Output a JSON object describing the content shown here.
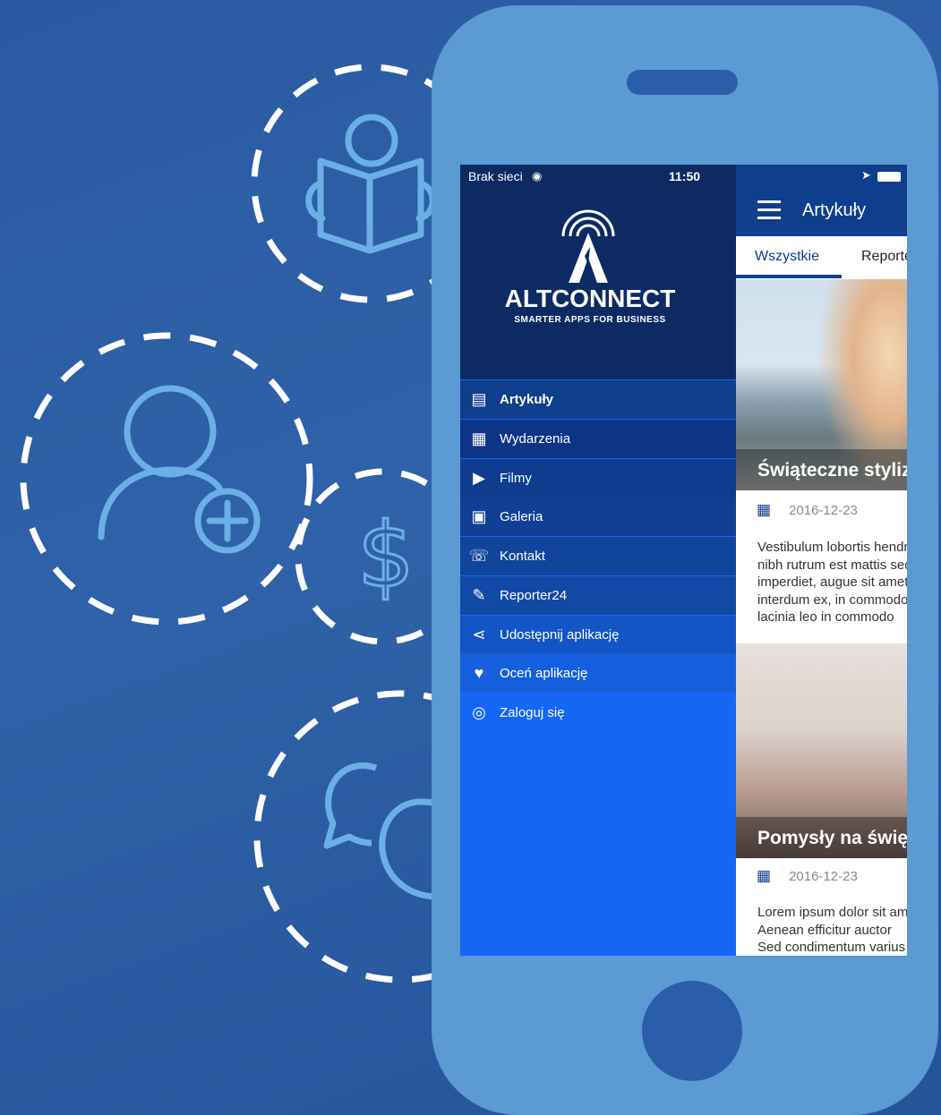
{
  "status_bar": {
    "carrier": "Brak sieci",
    "time": "11:50"
  },
  "brand": {
    "name": "ALTCONNECT",
    "tagline": "SMARTER APPS FOR BUSINESS"
  },
  "menu": [
    {
      "label": "Artykuły",
      "icon": "newspaper-icon",
      "active": true
    },
    {
      "label": "Wydarzenia",
      "icon": "calendar-icon"
    },
    {
      "label": "Filmy",
      "icon": "youtube-icon"
    },
    {
      "label": "Galeria",
      "icon": "gallery-icon"
    },
    {
      "label": "Kontakt",
      "icon": "contact-icon"
    },
    {
      "label": "Reporter24",
      "icon": "microphone-icon"
    },
    {
      "label": "Udostępnij aplikację",
      "icon": "share-icon"
    },
    {
      "label": "Oceń aplikację",
      "icon": "heart-icon"
    },
    {
      "label": "Zaloguj się",
      "icon": "user-icon"
    }
  ],
  "header": {
    "title": "Artykuły"
  },
  "tabs": [
    "Wszystkie",
    "Reporter"
  ],
  "articles": [
    {
      "title": "Świąteczne stylizacje",
      "date": "2016-12-23",
      "excerpt": "Vestibulum lobortis hendrerit\nnibh rutrum est mattis sed\nimperdiet, augue sit amet\ninterdum ex, in commodo\nlacinia leo in commodo"
    },
    {
      "title": "Pomysły na święta",
      "date": "2016-12-23",
      "excerpt": "Lorem ipsum dolor sit amet\nAenean efficitur auctor\nSed condimentum varius"
    }
  ],
  "colors": {
    "background": "#2a5aa3",
    "phone": "#5b9ad3",
    "drawer_top": "#0e2a63",
    "drawer": "#1566f5",
    "navbar": "#0f3e8c",
    "icon_line": "#6ab0e6"
  }
}
